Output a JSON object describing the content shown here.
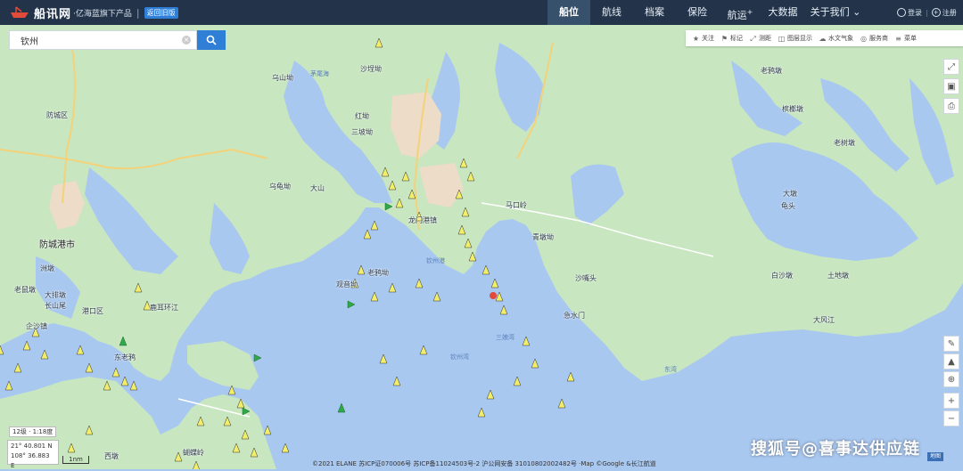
{
  "header": {
    "brand": "船讯网",
    "subtitle": "·亿海蓝旗下产品",
    "separator": "|",
    "badge": "返回旧版",
    "nav": [
      {
        "label": "船位",
        "active": true
      },
      {
        "label": "航线",
        "active": false
      },
      {
        "label": "档案",
        "active": false
      },
      {
        "label": "保险",
        "active": false
      },
      {
        "label": "航运",
        "active": false,
        "sup": "+"
      },
      {
        "label": "大数据",
        "active": false
      },
      {
        "label": "关于我们",
        "active": false
      }
    ],
    "login": "登录",
    "register": "注册"
  },
  "search": {
    "value": "钦州"
  },
  "toolbar": [
    {
      "icon": "star-icon",
      "label": "关注"
    },
    {
      "icon": "bookmark-icon",
      "label": "标记"
    },
    {
      "icon": "ruler-icon",
      "label": "测距"
    },
    {
      "icon": "layers-icon",
      "label": "图层显示"
    },
    {
      "icon": "weather-icon",
      "label": "水文气象"
    },
    {
      "icon": "service-icon",
      "label": "服务商"
    },
    {
      "icon": "menu-icon",
      "label": "菜单"
    }
  ],
  "places": [
    {
      "name": "防城区",
      "big": false
    },
    {
      "name": "防城港市",
      "big": true
    },
    {
      "name": "港口区",
      "big": false
    },
    {
      "name": "沙埕坳",
      "big": false
    },
    {
      "name": "乌山坳",
      "big": false
    },
    {
      "name": "红坳",
      "big": false
    },
    {
      "name": "三坡坳",
      "big": false
    },
    {
      "name": "乌龟坳",
      "big": false
    },
    {
      "name": "大山",
      "big": false
    },
    {
      "name": "老鸦坳",
      "big": false
    },
    {
      "name": "鹿耳环江",
      "big": false
    },
    {
      "name": "龙门港镇",
      "big": false
    },
    {
      "name": "观音坳",
      "big": false
    },
    {
      "name": "马口岭",
      "big": false
    },
    {
      "name": "青墩坳",
      "big": false
    },
    {
      "name": "急水门",
      "big": false
    },
    {
      "name": "沙嘴头",
      "big": false
    },
    {
      "name": "老鸦墩",
      "big": false
    },
    {
      "name": "槟榔墩",
      "big": false
    },
    {
      "name": "老树墩",
      "big": false
    },
    {
      "name": "大墩",
      "big": false
    },
    {
      "name": "龟头",
      "big": false
    },
    {
      "name": "白沙墩",
      "big": false
    },
    {
      "name": "土地墩",
      "big": false
    },
    {
      "name": "大风江",
      "big": false
    },
    {
      "name": "洲墩",
      "big": false
    },
    {
      "name": "老鼠墩",
      "big": false
    },
    {
      "name": "大排墩",
      "big": false
    },
    {
      "name": "长山尾",
      "big": false
    },
    {
      "name": "企沙镇",
      "big": false
    },
    {
      "name": "东老鸦",
      "big": false
    },
    {
      "name": "西墩",
      "big": false
    },
    {
      "name": "蝴蝶岭",
      "big": false
    }
  ],
  "waters": [
    "茅尾海",
    "钦州港",
    "三娘湾",
    "钦州湾",
    "东湾"
  ],
  "colors": {
    "topbar": "#23344a",
    "sea": "#a9c8f0",
    "land": "#c8e6c0",
    "vessel": "#f2ee6a",
    "accent": "#2f7fd6"
  },
  "zoom_label": "12级 · 1:18度",
  "coords": {
    "lat": "21° 40.801 N",
    "lon": "108° 36.883 E"
  },
  "scale_label": "1nm",
  "footer": "©2021 ELANE 苏ICP证070006号 苏ICP备11024503号-2 沪公网安备 31010802002482号 ·Map ©Google &长江航道",
  "watermark": "搜狐号@喜事达供应链",
  "minimap_label": "地图"
}
